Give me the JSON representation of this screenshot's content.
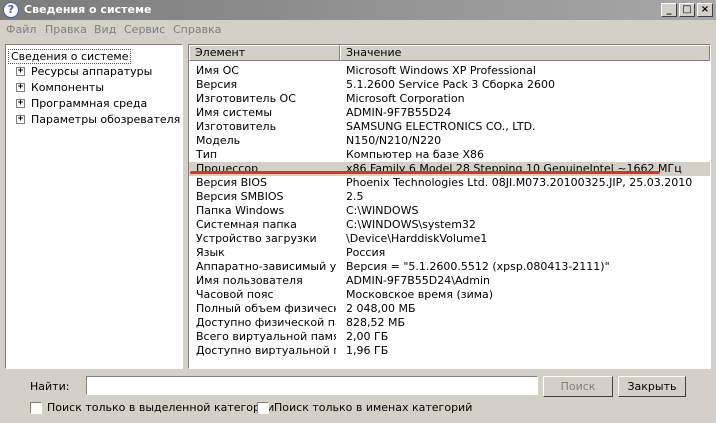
{
  "window": {
    "title": "Сведения о системе",
    "controls": {
      "minimize": "_",
      "maximize": "□",
      "close": "×"
    }
  },
  "menu": [
    "Файл",
    "Правка",
    "Вид",
    "Сервис",
    "Справка"
  ],
  "tree": {
    "root": "Сведения о системе",
    "items": [
      "Ресурсы аппаратуры",
      "Компоненты",
      "Программная среда",
      "Параметры обозревателя"
    ]
  },
  "list": {
    "columns": [
      "Элемент",
      "Значение"
    ],
    "rows": [
      [
        "Имя ОС",
        "Microsoft Windows XP Professional"
      ],
      [
        "Версия",
        "5.1.2600 Service Pack 3 Сборка 2600"
      ],
      [
        "Изготовитель ОС",
        "Microsoft Corporation"
      ],
      [
        "Имя системы",
        "ADMIN-9F7B55D24"
      ],
      [
        "Изготовитель",
        "SAMSUNG ELECTRONICS CO., LTD."
      ],
      [
        "Модель",
        "N150/N210/N220"
      ],
      [
        "Тип",
        "Компьютер на базе X86"
      ],
      [
        "Процессор",
        "x86 Family 6 Model 28 Stepping 10 GenuineIntel ~1662 МГц"
      ],
      [
        "Версия BIOS",
        "Phoenix Technologies Ltd. 08JI.M073.20100325.JIP, 25.03.2010"
      ],
      [
        "Версия SMBIOS",
        "2.5"
      ],
      [
        "Папка Windows",
        "C:\\WINDOWS"
      ],
      [
        "Системная папка",
        "C:\\WINDOWS\\system32"
      ],
      [
        "Устройство загрузки",
        "\\Device\\HarddiskVolume1"
      ],
      [
        "Язык",
        "Россия"
      ],
      [
        "Аппаратно-зависимый ур...",
        "Версия = \"5.1.2600.5512 (xpsp.080413-2111)\""
      ],
      [
        "Имя пользователя",
        "ADMIN-9F7B55D24\\Admin"
      ],
      [
        "Часовой пояс",
        "Московское время (зима)"
      ],
      [
        "Полный объем физическ...",
        "2 048,00 МБ"
      ],
      [
        "Доступно физической па...",
        "828,52 МБ"
      ],
      [
        "Всего виртуальной памяти",
        "2,00 ГБ"
      ],
      [
        "Доступно виртуальной па...",
        "1,96 ГБ"
      ]
    ],
    "selected_index": 7
  },
  "find": {
    "label": "Найти:",
    "value": "",
    "search_button": "Поиск",
    "close_button": "Закрыть",
    "checkbox_selected_category": "Поиск только в выделенной категории",
    "checkbox_category_names": "Поиск только в именах категорий"
  },
  "colors": {
    "highlight_line": "#e82c2c",
    "selected_row": "#d4d0c8",
    "title_bar": "#8a8a8a"
  }
}
